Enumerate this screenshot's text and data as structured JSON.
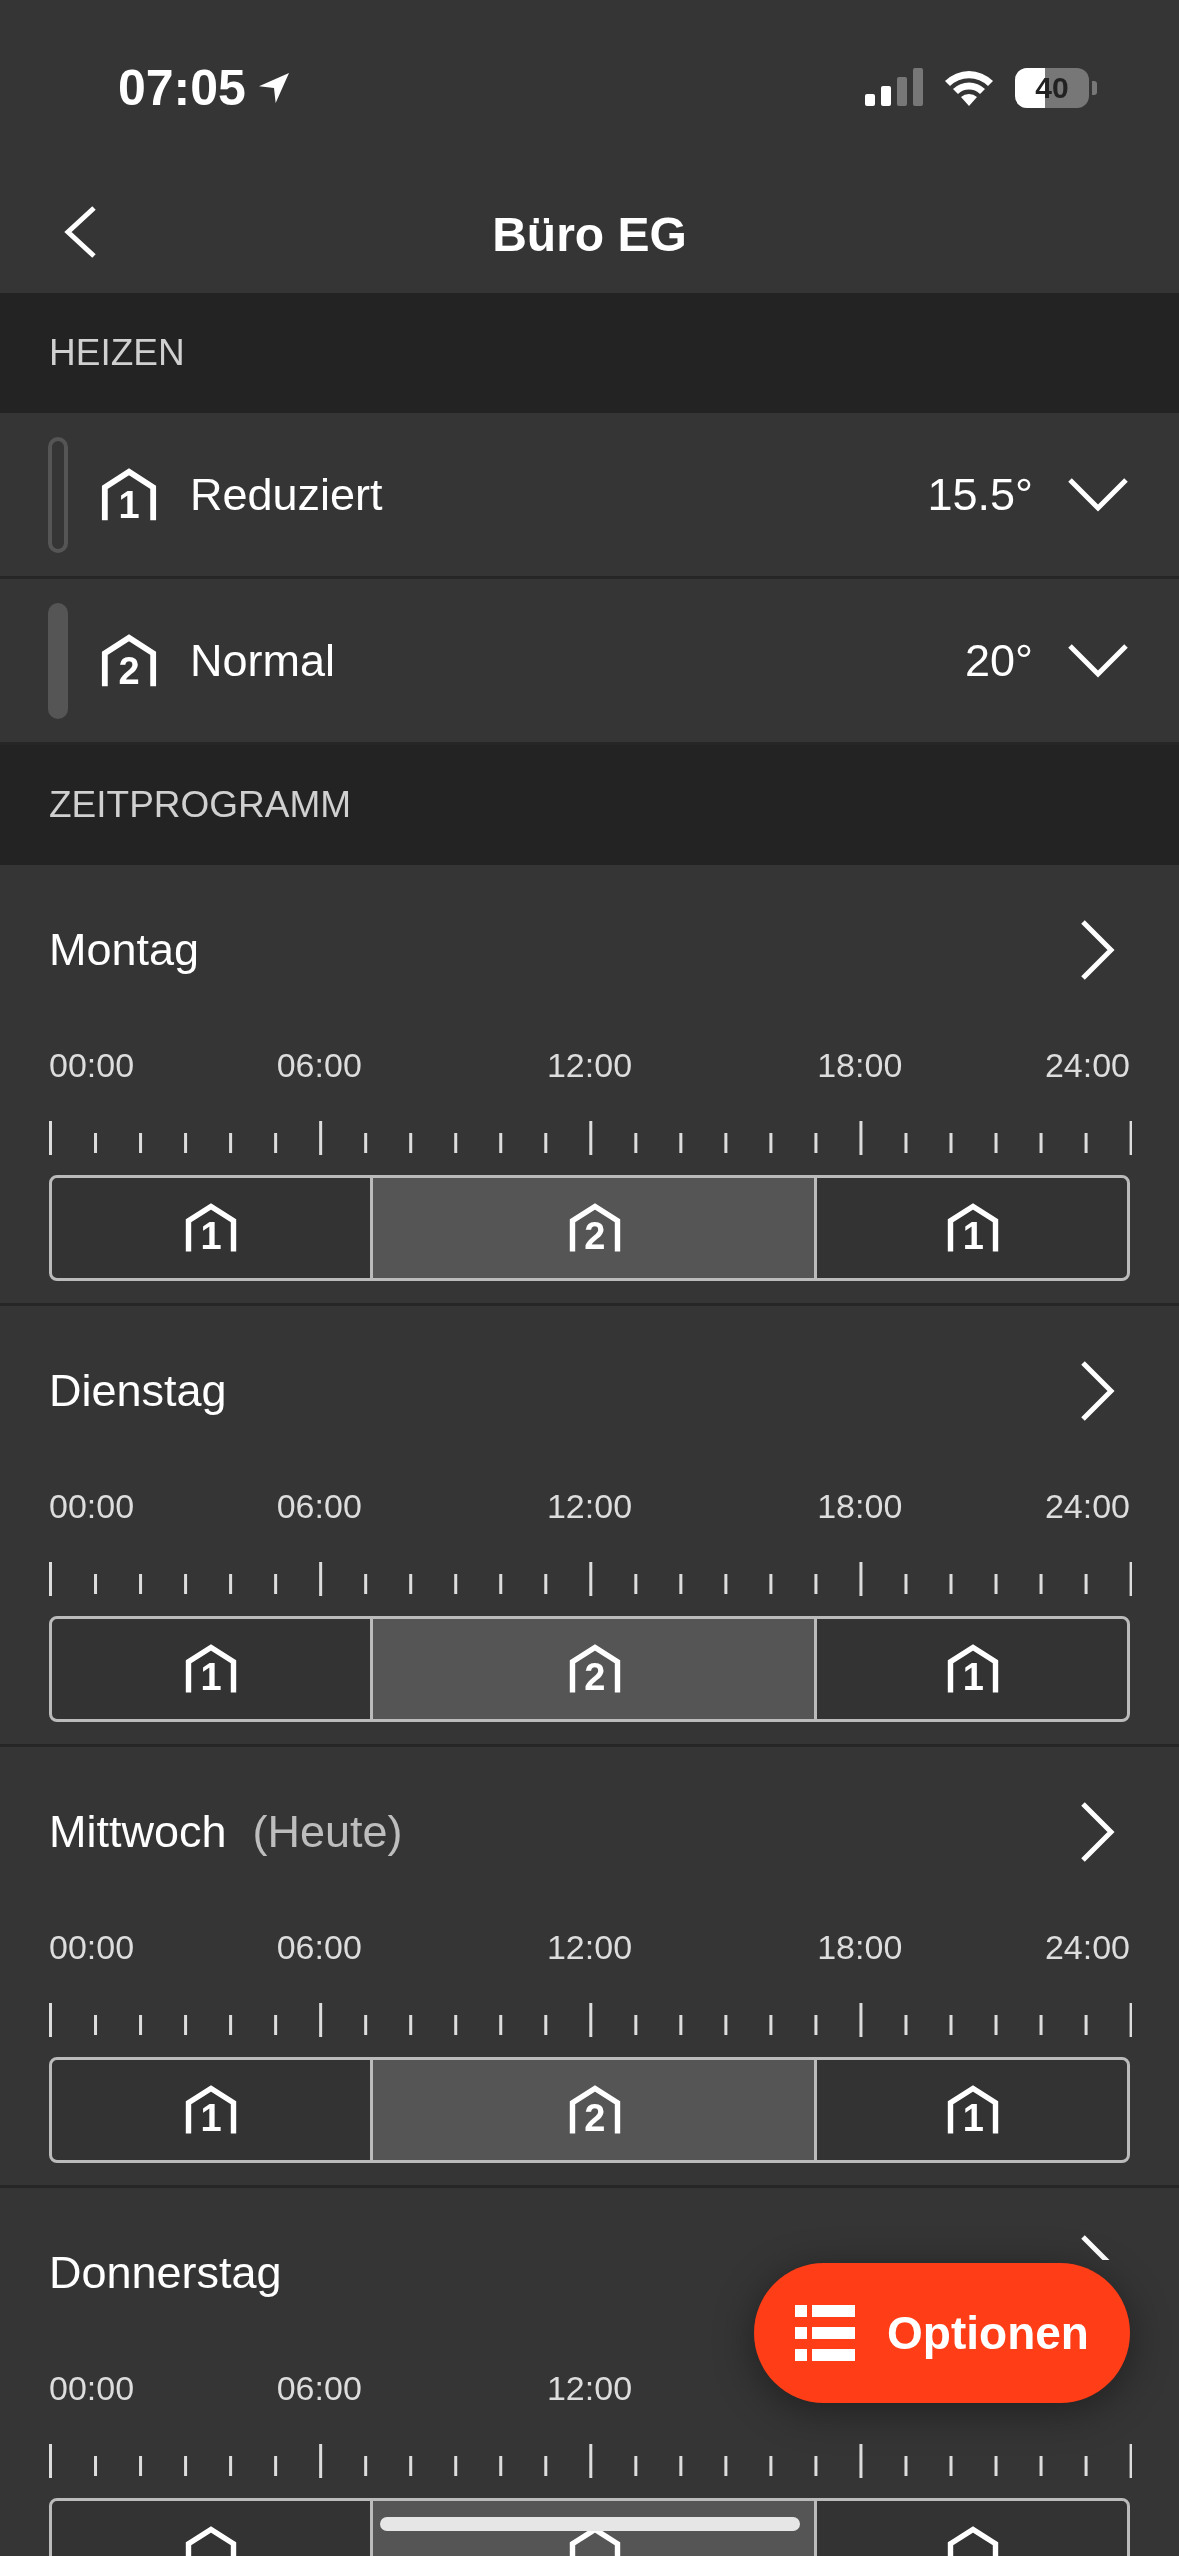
{
  "status_bar": {
    "time": "07:05",
    "battery": "40"
  },
  "header": {
    "title": "Büro EG"
  },
  "heating": {
    "title": "HEIZEN",
    "modes": [
      {
        "kind": "reduced",
        "icon_number": "1",
        "label": "Reduziert",
        "temperature": "15.5°"
      },
      {
        "kind": "normal",
        "icon_number": "2",
        "label": "Normal",
        "temperature": "20°"
      }
    ]
  },
  "schedule": {
    "title": "ZEITPROGRAMM",
    "days": [
      {
        "name": "Montag",
        "chevron_covered": false,
        "axis": [
          "00:00",
          "06:00",
          "12:00",
          "18:00",
          "24:00"
        ],
        "segments": [
          {
            "kind": "reduced",
            "icon_number": "1"
          },
          {
            "kind": "normal",
            "icon_number": "2"
          },
          {
            "kind": "reduced",
            "icon_number": "1"
          }
        ]
      },
      {
        "name": "Dienstag",
        "chevron_covered": false,
        "axis": [
          "00:00",
          "06:00",
          "12:00",
          "18:00",
          "24:00"
        ],
        "segments": [
          {
            "kind": "reduced",
            "icon_number": "1"
          },
          {
            "kind": "normal",
            "icon_number": "2"
          },
          {
            "kind": "reduced",
            "icon_number": "1"
          }
        ]
      },
      {
        "name": "Mittwoch",
        "chevron_covered": false,
        "note": "(Heute)",
        "axis": [
          "00:00",
          "06:00",
          "12:00",
          "18:00",
          "24:00"
        ],
        "segments": [
          {
            "kind": "reduced",
            "icon_number": "1"
          },
          {
            "kind": "normal",
            "icon_number": "2"
          },
          {
            "kind": "reduced",
            "icon_number": "1"
          }
        ]
      },
      {
        "name": "Donnerstag",
        "chevron_covered": true,
        "axis": [
          "00:00",
          "06:00",
          "12:00"
        ],
        "segments": [
          {
            "kind": "reduced"
          },
          {
            "kind": "normal"
          },
          {
            "kind": "reduced"
          }
        ]
      }
    ]
  },
  "options_button": {
    "label": "Optionen"
  }
}
